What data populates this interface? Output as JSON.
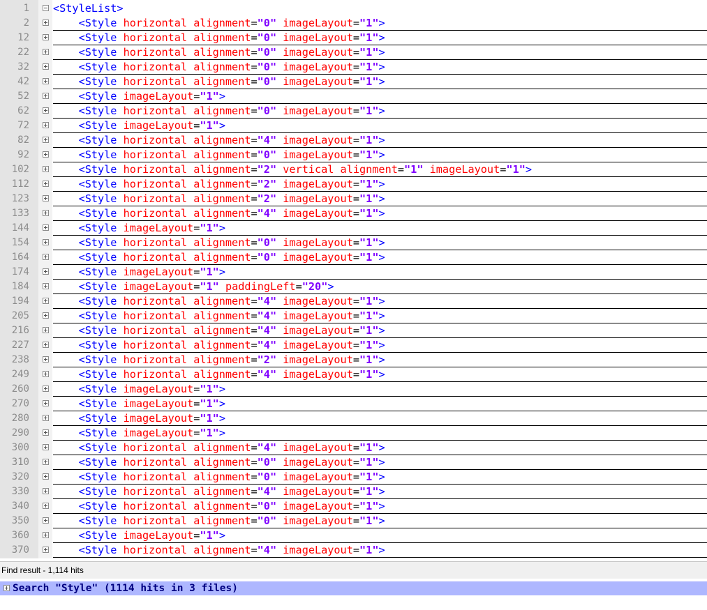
{
  "editor": {
    "lines": [
      {
        "num": "1",
        "fold": "minus",
        "indent": false,
        "attrs": [],
        "tag": "<StyleList>",
        "close": ""
      },
      {
        "num": "2",
        "fold": "plus",
        "indent": true,
        "attrs": [
          [
            "horizontal alignment",
            "0"
          ],
          [
            "imageLayout",
            "1"
          ]
        ],
        "tag": "<Style",
        "close": ">"
      },
      {
        "num": "12",
        "fold": "plus",
        "indent": true,
        "attrs": [
          [
            "horizontal alignment",
            "0"
          ],
          [
            "imageLayout",
            "1"
          ]
        ],
        "tag": "<Style",
        "close": ">"
      },
      {
        "num": "22",
        "fold": "plus",
        "indent": true,
        "attrs": [
          [
            "horizontal alignment",
            "0"
          ],
          [
            "imageLayout",
            "1"
          ]
        ],
        "tag": "<Style",
        "close": ">"
      },
      {
        "num": "32",
        "fold": "plus",
        "indent": true,
        "attrs": [
          [
            "horizontal alignment",
            "0"
          ],
          [
            "imageLayout",
            "1"
          ]
        ],
        "tag": "<Style",
        "close": ">"
      },
      {
        "num": "42",
        "fold": "plus",
        "indent": true,
        "attrs": [
          [
            "horizontal alignment",
            "0"
          ],
          [
            "imageLayout",
            "1"
          ]
        ],
        "tag": "<Style",
        "close": ">"
      },
      {
        "num": "52",
        "fold": "plus",
        "indent": true,
        "attrs": [
          [
            "imageLayout",
            "1"
          ]
        ],
        "tag": "<Style",
        "close": ">"
      },
      {
        "num": "62",
        "fold": "plus",
        "indent": true,
        "attrs": [
          [
            "horizontal alignment",
            "0"
          ],
          [
            "imageLayout",
            "1"
          ]
        ],
        "tag": "<Style",
        "close": ">"
      },
      {
        "num": "72",
        "fold": "plus",
        "indent": true,
        "attrs": [
          [
            "imageLayout",
            "1"
          ]
        ],
        "tag": "<Style",
        "close": ">"
      },
      {
        "num": "82",
        "fold": "plus",
        "indent": true,
        "attrs": [
          [
            "horizontal alignment",
            "4"
          ],
          [
            "imageLayout",
            "1"
          ]
        ],
        "tag": "<Style",
        "close": ">"
      },
      {
        "num": "92",
        "fold": "plus",
        "indent": true,
        "attrs": [
          [
            "horizontal alignment",
            "0"
          ],
          [
            "imageLayout",
            "1"
          ]
        ],
        "tag": "<Style",
        "close": ">"
      },
      {
        "num": "102",
        "fold": "plus",
        "indent": true,
        "attrs": [
          [
            "horizontal alignment",
            "2"
          ],
          [
            "vertical alignment",
            "1"
          ],
          [
            "imageLayout",
            "1"
          ]
        ],
        "tag": "<Style",
        "close": ">"
      },
      {
        "num": "112",
        "fold": "plus",
        "indent": true,
        "attrs": [
          [
            "horizontal alignment",
            "2"
          ],
          [
            "imageLayout",
            "1"
          ]
        ],
        "tag": "<Style",
        "close": ">"
      },
      {
        "num": "123",
        "fold": "plus",
        "indent": true,
        "attrs": [
          [
            "horizontal alignment",
            "2"
          ],
          [
            "imageLayout",
            "1"
          ]
        ],
        "tag": "<Style",
        "close": ">"
      },
      {
        "num": "133",
        "fold": "plus",
        "indent": true,
        "attrs": [
          [
            "horizontal alignment",
            "4"
          ],
          [
            "imageLayout",
            "1"
          ]
        ],
        "tag": "<Style",
        "close": ">"
      },
      {
        "num": "144",
        "fold": "plus",
        "indent": true,
        "attrs": [
          [
            "imageLayout",
            "1"
          ]
        ],
        "tag": "<Style",
        "close": ">"
      },
      {
        "num": "154",
        "fold": "plus",
        "indent": true,
        "attrs": [
          [
            "horizontal alignment",
            "0"
          ],
          [
            "imageLayout",
            "1"
          ]
        ],
        "tag": "<Style",
        "close": ">"
      },
      {
        "num": "164",
        "fold": "plus",
        "indent": true,
        "attrs": [
          [
            "horizontal alignment",
            "0"
          ],
          [
            "imageLayout",
            "1"
          ]
        ],
        "tag": "<Style",
        "close": ">"
      },
      {
        "num": "174",
        "fold": "plus",
        "indent": true,
        "attrs": [
          [
            "imageLayout",
            "1"
          ]
        ],
        "tag": "<Style",
        "close": ">"
      },
      {
        "num": "184",
        "fold": "plus",
        "indent": true,
        "attrs": [
          [
            "imageLayout",
            "1"
          ],
          [
            "paddingLeft",
            "20"
          ]
        ],
        "tag": "<Style",
        "close": ">"
      },
      {
        "num": "194",
        "fold": "plus",
        "indent": true,
        "attrs": [
          [
            "horizontal alignment",
            "4"
          ],
          [
            "imageLayout",
            "1"
          ]
        ],
        "tag": "<Style",
        "close": ">"
      },
      {
        "num": "205",
        "fold": "plus",
        "indent": true,
        "attrs": [
          [
            "horizontal alignment",
            "4"
          ],
          [
            "imageLayout",
            "1"
          ]
        ],
        "tag": "<Style",
        "close": ">"
      },
      {
        "num": "216",
        "fold": "plus",
        "indent": true,
        "attrs": [
          [
            "horizontal alignment",
            "4"
          ],
          [
            "imageLayout",
            "1"
          ]
        ],
        "tag": "<Style",
        "close": ">"
      },
      {
        "num": "227",
        "fold": "plus",
        "indent": true,
        "attrs": [
          [
            "horizontal alignment",
            "4"
          ],
          [
            "imageLayout",
            "1"
          ]
        ],
        "tag": "<Style",
        "close": ">"
      },
      {
        "num": "238",
        "fold": "plus",
        "indent": true,
        "attrs": [
          [
            "horizontal alignment",
            "2"
          ],
          [
            "imageLayout",
            "1"
          ]
        ],
        "tag": "<Style",
        "close": ">"
      },
      {
        "num": "249",
        "fold": "plus",
        "indent": true,
        "attrs": [
          [
            "horizontal alignment",
            "4"
          ],
          [
            "imageLayout",
            "1"
          ]
        ],
        "tag": "<Style",
        "close": ">"
      },
      {
        "num": "260",
        "fold": "plus",
        "indent": true,
        "attrs": [
          [
            "imageLayout",
            "1"
          ]
        ],
        "tag": "<Style",
        "close": ">"
      },
      {
        "num": "270",
        "fold": "plus",
        "indent": true,
        "attrs": [
          [
            "imageLayout",
            "1"
          ]
        ],
        "tag": "<Style",
        "close": ">"
      },
      {
        "num": "280",
        "fold": "plus",
        "indent": true,
        "attrs": [
          [
            "imageLayout",
            "1"
          ]
        ],
        "tag": "<Style",
        "close": ">"
      },
      {
        "num": "290",
        "fold": "plus",
        "indent": true,
        "attrs": [
          [
            "imageLayout",
            "1"
          ]
        ],
        "tag": "<Style",
        "close": ">"
      },
      {
        "num": "300",
        "fold": "plus",
        "indent": true,
        "attrs": [
          [
            "horizontal alignment",
            "4"
          ],
          [
            "imageLayout",
            "1"
          ]
        ],
        "tag": "<Style",
        "close": ">"
      },
      {
        "num": "310",
        "fold": "plus",
        "indent": true,
        "attrs": [
          [
            "horizontal alignment",
            "0"
          ],
          [
            "imageLayout",
            "1"
          ]
        ],
        "tag": "<Style",
        "close": ">"
      },
      {
        "num": "320",
        "fold": "plus",
        "indent": true,
        "attrs": [
          [
            "horizontal alignment",
            "0"
          ],
          [
            "imageLayout",
            "1"
          ]
        ],
        "tag": "<Style",
        "close": ">"
      },
      {
        "num": "330",
        "fold": "plus",
        "indent": true,
        "attrs": [
          [
            "horizontal alignment",
            "4"
          ],
          [
            "imageLayout",
            "1"
          ]
        ],
        "tag": "<Style",
        "close": ">"
      },
      {
        "num": "340",
        "fold": "plus",
        "indent": true,
        "attrs": [
          [
            "horizontal alignment",
            "0"
          ],
          [
            "imageLayout",
            "1"
          ]
        ],
        "tag": "<Style",
        "close": ">"
      },
      {
        "num": "350",
        "fold": "plus",
        "indent": true,
        "attrs": [
          [
            "horizontal alignment",
            "0"
          ],
          [
            "imageLayout",
            "1"
          ]
        ],
        "tag": "<Style",
        "close": ">"
      },
      {
        "num": "360",
        "fold": "plus",
        "indent": true,
        "attrs": [
          [
            "imageLayout",
            "1"
          ]
        ],
        "tag": "<Style",
        "close": ">"
      },
      {
        "num": "370",
        "fold": "plus",
        "indent": true,
        "attrs": [
          [
            "horizontal alignment",
            "4"
          ],
          [
            "imageLayout",
            "1"
          ]
        ],
        "tag": "<Style",
        "close": ">"
      }
    ]
  },
  "find_panel": {
    "title": "Find result - 1,114 hits",
    "result_header": "Search \"Style\" (1114 hits in 3 files)"
  },
  "colors": {
    "tag": "#0000ff",
    "attribute": "#ff0000",
    "value": "#8000ff",
    "result_highlight": "#aeb7ff"
  },
  "icons": {
    "fold_expanded": "fold-minus-icon",
    "fold_collapsed": "fold-plus-icon"
  }
}
